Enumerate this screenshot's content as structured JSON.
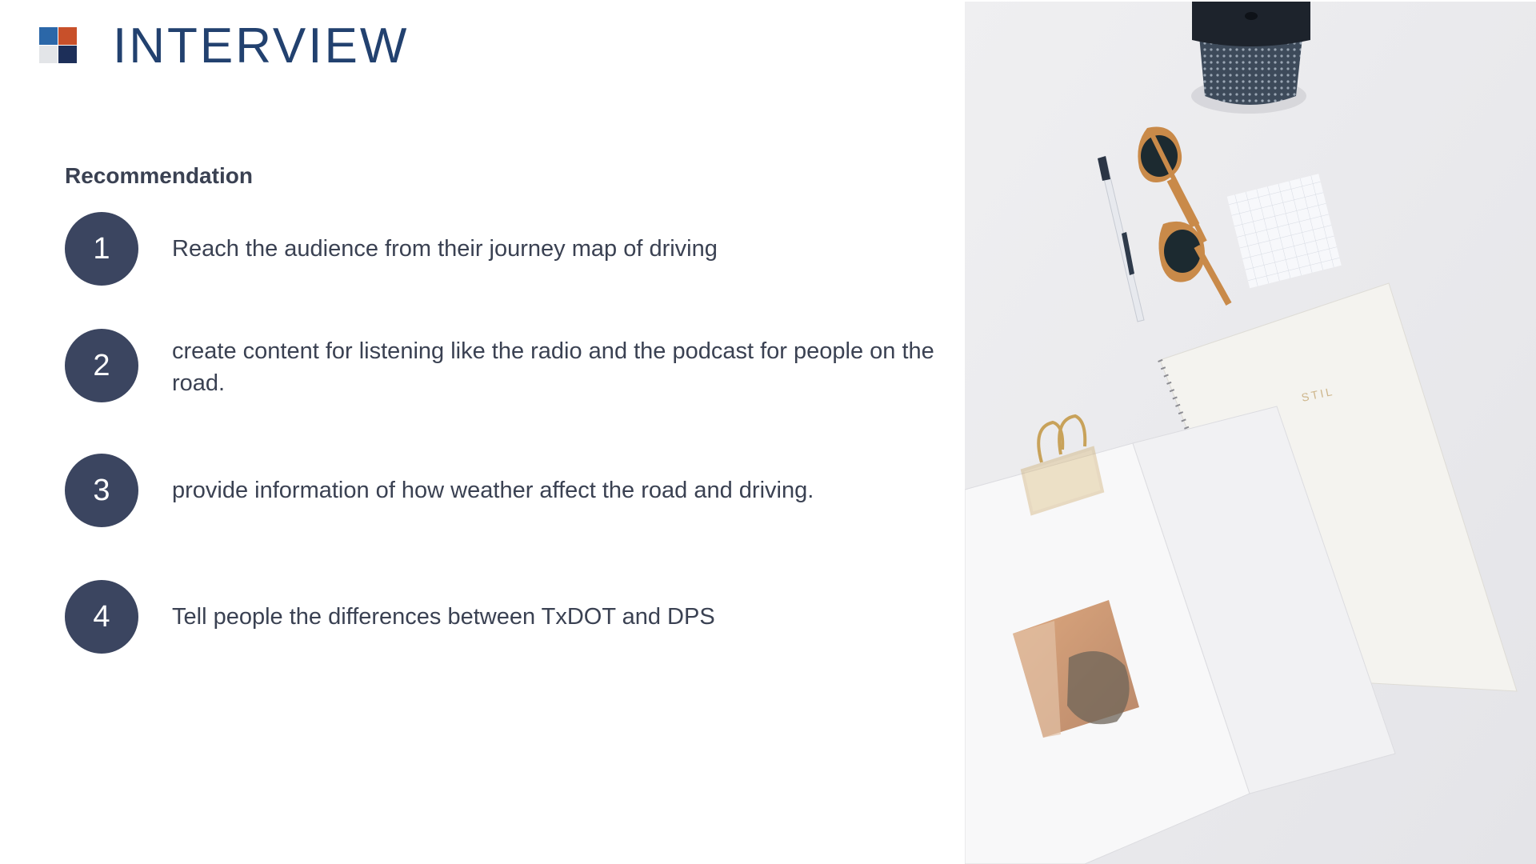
{
  "header": {
    "title": "INTERVIEW"
  },
  "section": {
    "heading": "Recommendation"
  },
  "recommendations": [
    {
      "number": "1",
      "text": "Reach the audience from their journey map of driving"
    },
    {
      "number": "2",
      "text": "create content for listening like the radio and the podcast for people on the road."
    },
    {
      "number": "3",
      "text": "provide information of how weather affect the road and driving."
    },
    {
      "number": "4",
      "text": "Tell people the differences between TxDOT and DPS"
    }
  ],
  "photo": {
    "notebook_cover_text": "STIL"
  },
  "colors": {
    "title": "#22416f",
    "circle": "#3b4560",
    "body_text": "#3a4152",
    "logo_blue": "#2b67a8",
    "logo_orange": "#c8502a",
    "logo_navy": "#1d2f59",
    "logo_gray": "#e3e5e8"
  }
}
